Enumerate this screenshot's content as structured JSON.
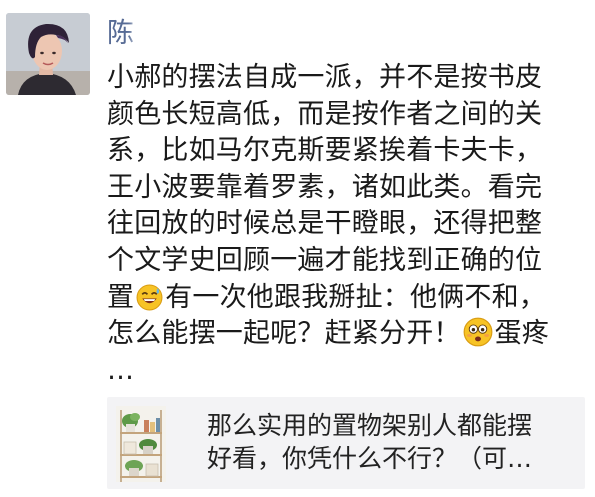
{
  "post": {
    "username": "陈",
    "lines": [
      "小郝的摆法自成一派，并不是按书皮",
      "颜色长短高低，而是按作者之间的关",
      "系，比如马尔克斯要紧挨着卡夫卡，",
      "王小波要靠着罗素，诸如此类。看完",
      "往回放的时候总是干瞪眼，还得把整",
      "个文学史回顾一遍才能找到正确的位"
    ],
    "line7_before": "置",
    "line7_after": "有一次他跟我掰扯：他俩不和，",
    "line8_before": "怎么能摆一起呢？赶紧分开！",
    "line8_after": "蛋疼",
    "line9": "…",
    "emojis": [
      "grinning-sweat-emoji",
      "flushed-face-emoji"
    ]
  },
  "link_card": {
    "lines": [
      "那么实用的置物架别人都能摆",
      "好看，你凭什么不行？（可…"
    ],
    "thumbnail": "bookshelf-with-plants"
  }
}
